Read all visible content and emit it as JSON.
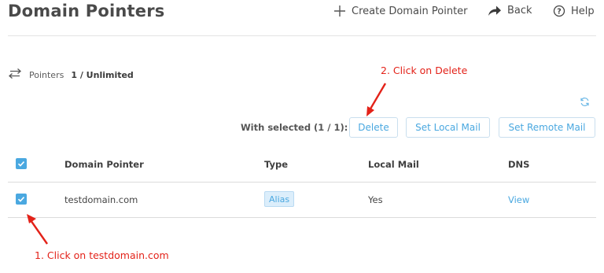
{
  "header": {
    "title": "Domain Pointers",
    "create_label": "Create Domain Pointer",
    "back_label": "Back",
    "help_label": "Help"
  },
  "stats": {
    "label": "Pointers",
    "value": "1 / Unlimited"
  },
  "toolbar": {
    "with_selected": "With selected (1 / 1):",
    "delete_label": "Delete",
    "set_local_mail_label": "Set Local Mail",
    "set_remote_mail_label": "Set Remote Mail"
  },
  "table": {
    "columns": [
      "Domain Pointer",
      "Type",
      "Local Mail",
      "DNS"
    ],
    "rows": [
      {
        "domain": "testdomain.com",
        "type": "Alias",
        "local_mail": "Yes",
        "dns": "View",
        "checked": true
      }
    ],
    "select_all_checked": true
  },
  "annotations": {
    "step1": "1. Click on testdomain.com",
    "step2": "2. Click on Delete"
  },
  "colors": {
    "accent": "#4aa8e0",
    "annotation": "#e32219",
    "text": "#4a4a4a"
  },
  "icons": [
    "plus-icon",
    "share-arrow-icon",
    "help-circle-icon",
    "transfer-arrows-icon",
    "refresh-icon",
    "checkmark-icon"
  ]
}
